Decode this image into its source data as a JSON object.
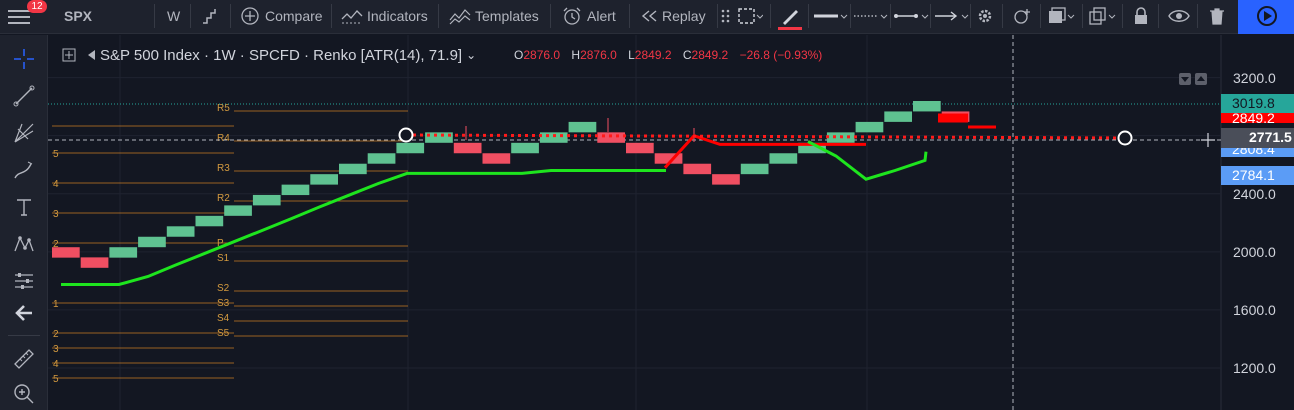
{
  "toolbar": {
    "symbol": "SPX",
    "notification_count": "12",
    "interval": "W",
    "compare_label": "Compare",
    "indicators_label": "Indicators",
    "templates_label": "Templates",
    "alert_label": "Alert",
    "replay_label": "Replay"
  },
  "legend": {
    "title": "S&P 500 Index · 1W · SPCFD · Renko [ATR(14), 71.9]",
    "open_key": "O",
    "open": "2876.0",
    "high_key": "H",
    "high": "2876.0",
    "low_key": "L",
    "low": "2849.2",
    "close_key": "C",
    "close": "2849.2",
    "change": "−26.8 (−0.93%)"
  },
  "price_axis": {
    "ticks": [
      "3200.0",
      "2800.0",
      "2400.0",
      "2000.0",
      "1600.0",
      "1200.0"
    ],
    "labels": [
      {
        "text": "3019.8",
        "bg": "#26a69a",
        "fg": "#131722"
      },
      {
        "text": "2849.2",
        "bg": "#ff0000",
        "fg": "#ffffff"
      },
      {
        "text": "2808.4",
        "bg": "#5b9cf6",
        "fg": "#ffffff"
      },
      {
        "text": "2771.5",
        "bg": "#4a4e59",
        "fg": "#ffffff"
      },
      {
        "text": "2784.1",
        "bg": "#5b9cf6",
        "fg": "#ffffff"
      }
    ]
  },
  "pivot_labels": {
    "left_group": [
      "5",
      "4",
      "3",
      "2",
      "1",
      "2",
      "3",
      "4",
      "5"
    ],
    "right_group": [
      "R5",
      "R4",
      "R3",
      "R2",
      "P",
      "S1",
      "S2",
      "S3",
      "S4",
      "S5"
    ]
  },
  "chart_data": {
    "type": "renko",
    "brick_size": 71.9,
    "bricks_y_bottom": [
      1960,
      1890,
      1960,
      2032,
      2104,
      2176,
      2248,
      2320,
      2391,
      2463,
      2535,
      2607,
      2679,
      2751,
      2679,
      2607,
      2679,
      2751,
      2823,
      2751,
      2679,
      2607,
      2535,
      2463,
      2535,
      2607,
      2679,
      2751,
      2823,
      2895,
      2967,
      2895
    ],
    "bricks_dir": [
      "down",
      "down",
      "up",
      "up",
      "up",
      "up",
      "up",
      "up",
      "up",
      "up",
      "up",
      "up",
      "up",
      "up",
      "down",
      "down",
      "up",
      "up",
      "up",
      "down",
      "down",
      "down",
      "down",
      "down",
      "up",
      "up",
      "up",
      "up",
      "up",
      "up",
      "up",
      "down"
    ],
    "green_line": [
      1775,
      1775,
      1775,
      1830,
      1910,
      1990,
      2070,
      2150,
      2230,
      2310,
      2390,
      2470,
      2540,
      2540,
      2540,
      2540,
      2540,
      2560,
      2560,
      2560,
      2560,
      2560
    ],
    "red_line": [
      2580,
      2800,
      2740,
      2740,
      2740,
      2740,
      2740,
      2740
    ],
    "green_line_2": [
      2760,
      2660,
      2500,
      2560,
      2630,
      2690
    ],
    "price_line": 2849.2,
    "ylim": [
      1050,
      3300
    ]
  }
}
